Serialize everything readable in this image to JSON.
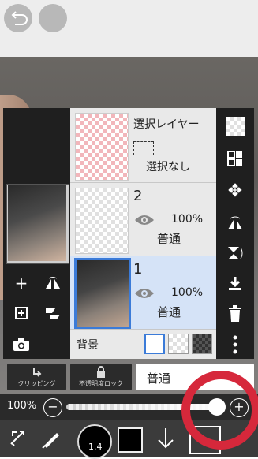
{
  "layer_panel": {
    "selection_layer": {
      "title": "選択レイヤー",
      "status": "選択なし"
    },
    "layers": [
      {
        "number": "2",
        "opacity": "100%",
        "blend": "普通"
      },
      {
        "number": "1",
        "opacity": "100%",
        "blend": "普通"
      }
    ],
    "background": {
      "label": "背景"
    }
  },
  "controls": {
    "clipping_label": "クリッピング",
    "alpha_lock_label": "不透明度ロック",
    "blend_mode": "普通",
    "opacity_value": "100%",
    "opacity_fraction": 1.0
  },
  "toolbar": {
    "brush_size": "1.4"
  },
  "icons": [
    "undo-icon",
    "plus-icon",
    "flip-icon",
    "add-layer-icon",
    "merge-down-icon",
    "camera-icon",
    "checker-icon",
    "transform-icon",
    "move-icon",
    "flip-horizontal-icon",
    "flip-vertical-icon",
    "download-icon",
    "trash-icon",
    "more-icon",
    "minus-icon",
    "plus-circle-icon",
    "pen-icon",
    "swap-icon",
    "arrow-down-icon",
    "lock-icon"
  ],
  "colors": {
    "accent": "#3b7bd8",
    "selected_row": "#d5e3f7",
    "annotation_ring": "#d6283b"
  }
}
